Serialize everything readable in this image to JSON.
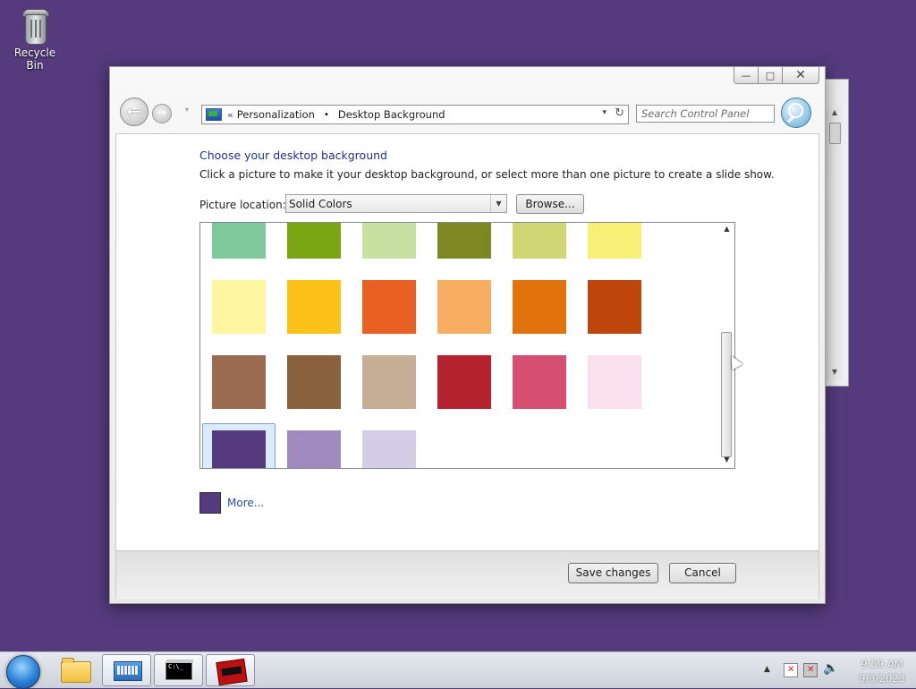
{
  "desktop": {
    "background_color": "#553b7e",
    "icons": [
      {
        "label": "Recycle Bin",
        "icon": "recycle-bin-icon"
      }
    ]
  },
  "window": {
    "caption_buttons": {
      "minimize": "—",
      "maximize": "□",
      "close": "✕"
    },
    "navigation": {
      "back": "←",
      "forward": "→"
    },
    "address_bar": {
      "chevron": "«",
      "crumbs": [
        "Personalization",
        "Desktop Background"
      ],
      "separator": "•",
      "dropdown": "▾",
      "refresh": "↻"
    },
    "search": {
      "placeholder": "Search Control Panel"
    },
    "content": {
      "title": "Choose your desktop background",
      "description": "Click a picture to make it your desktop background, or select more than one picture to create a slide show.",
      "picture_location_label": "Picture location:",
      "picture_location_value": "Solid Colors",
      "browse_label": "Browse...",
      "swatches": [
        {
          "color": "#7dc99b"
        },
        {
          "color": "#79a612"
        },
        {
          "color": "#c8e1a2"
        },
        {
          "color": "#7e8822"
        },
        {
          "color": "#d2d574"
        },
        {
          "color": "#f8ef76"
        },
        {
          "color": "#fdf5a0"
        },
        {
          "color": "#fcc219"
        },
        {
          "color": "#e86022"
        },
        {
          "color": "#f8ae62"
        },
        {
          "color": "#e2730c"
        },
        {
          "color": "#be450b"
        },
        {
          "color": "#9b6b52"
        },
        {
          "color": "#8b623e"
        },
        {
          "color": "#c7ae97"
        },
        {
          "color": "#b5232f"
        },
        {
          "color": "#d64f70"
        },
        {
          "color": "#fadfec"
        },
        {
          "color": "#553b7e",
          "selected": true
        },
        {
          "color": "#a08ac0"
        },
        {
          "color": "#d5cde7"
        }
      ],
      "more_color": "#553b7e",
      "more_label": "More..."
    },
    "footer": {
      "save_label": "Save changes",
      "cancel_label": "Cancel"
    }
  },
  "taskbar": {
    "items": [
      {
        "name": "file-explorer",
        "icon": "folder-icon"
      },
      {
        "name": "on-screen-keyboard",
        "icon": "keyboard-icon",
        "active": true
      },
      {
        "name": "command-prompt",
        "icon": "cmd-icon",
        "text": "C:\\_",
        "active": true
      },
      {
        "name": "game-app",
        "icon": "game-icon",
        "active": true
      }
    ],
    "tray": {
      "show_hidden": "▲",
      "volume": "🔈"
    },
    "clock": {
      "time": "9:59 AM",
      "date": "9/3/2023"
    }
  }
}
